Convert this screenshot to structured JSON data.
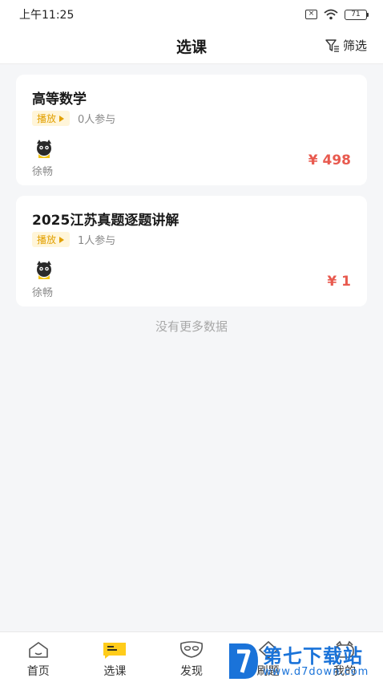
{
  "status_bar": {
    "time": "上午11:25",
    "battery_level": "71",
    "sim_icon": "sim-off-icon",
    "wifi_icon": "wifi-icon",
    "battery_icon": "battery-icon"
  },
  "header": {
    "title": "选课",
    "filter_label": "筛选",
    "filter_icon": "filter-icon"
  },
  "courses": [
    {
      "title": "高等数学",
      "tag": "播放",
      "participants": "0人参与",
      "teacher": "徐畅",
      "price": "¥ 498"
    },
    {
      "title": "2025江苏真题逐题讲解",
      "tag": "播放",
      "participants": "1人参与",
      "teacher": "徐畅",
      "price": "¥ 1"
    }
  ],
  "list_footer": "没有更多数据",
  "bottom_nav": [
    {
      "label": "首页",
      "icon": "home-icon"
    },
    {
      "label": "选课",
      "icon": "select-course-icon",
      "active": true
    },
    {
      "label": "发现",
      "icon": "discover-mask-icon"
    },
    {
      "label": "刷题",
      "icon": "practice-icon"
    },
    {
      "label": "我的",
      "icon": "profile-icon"
    }
  ],
  "watermark": {
    "main": "第七下载站",
    "sub": "www.d7down.com"
  },
  "colors": {
    "price": "#e85a4f",
    "tag_bg": "#fff5d9",
    "tag_text": "#e2a000",
    "active_nav": "#ffcc1a",
    "watermark": "#1a73d9"
  }
}
